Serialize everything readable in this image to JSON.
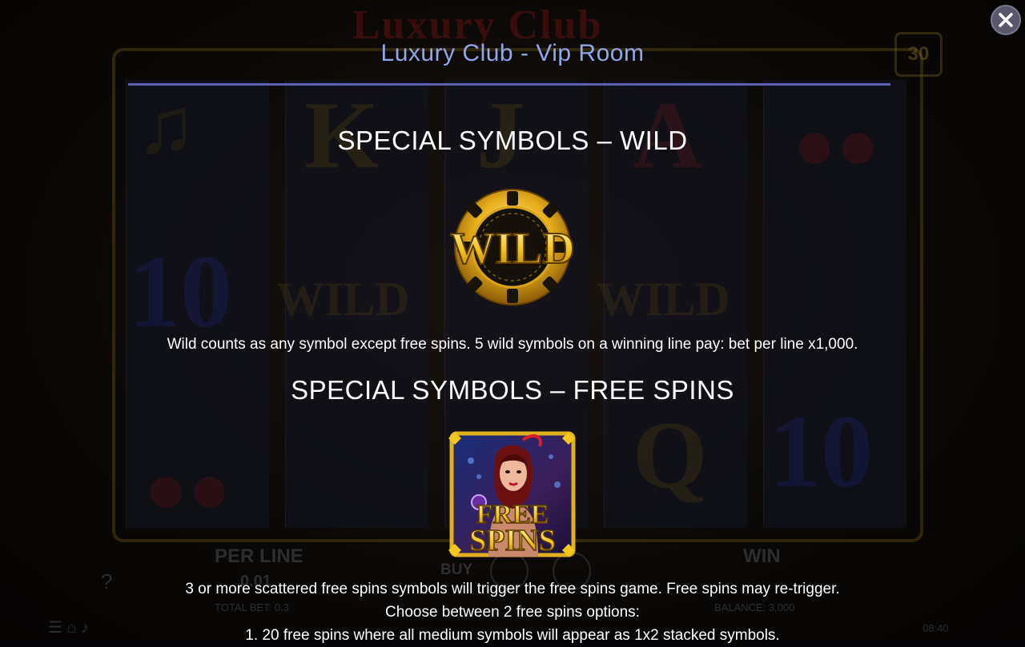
{
  "background": {
    "title": "Luxury Club",
    "counter": "30",
    "per_line_label": "PER LINE",
    "per_line_value": "0.01",
    "total_bet": "TOTAL BET: 0.3",
    "buy_label": "BUY",
    "win_label": "WIN",
    "balance": "BALANCE: 3,000",
    "clock": "08:40"
  },
  "overlay": {
    "title": "Luxury Club - Vip Room",
    "close_icon": "close-icon",
    "wild": {
      "heading": "SPECIAL SYMBOLS – WILD",
      "symbol_text": "WILD",
      "description": "Wild counts as any symbol except free spins. 5 wild symbols on a winning line pay: bet per line x1,000."
    },
    "free_spins": {
      "heading": "SPECIAL SYMBOLS – FREE SPINS",
      "symbol_line1": "FREE",
      "symbol_line2": "SPINS",
      "line1": "3 or more scattered free spins symbols will trigger the free spins game. Free spins may re-trigger.",
      "line2": "Choose between 2 free spins options:",
      "line3": "1. 20 free spins where all medium symbols will appear as 1x2 stacked symbols."
    }
  },
  "colors": {
    "title": "#8fa6e8",
    "divider": "#5d5fb0",
    "gold": "#f2c81c"
  }
}
